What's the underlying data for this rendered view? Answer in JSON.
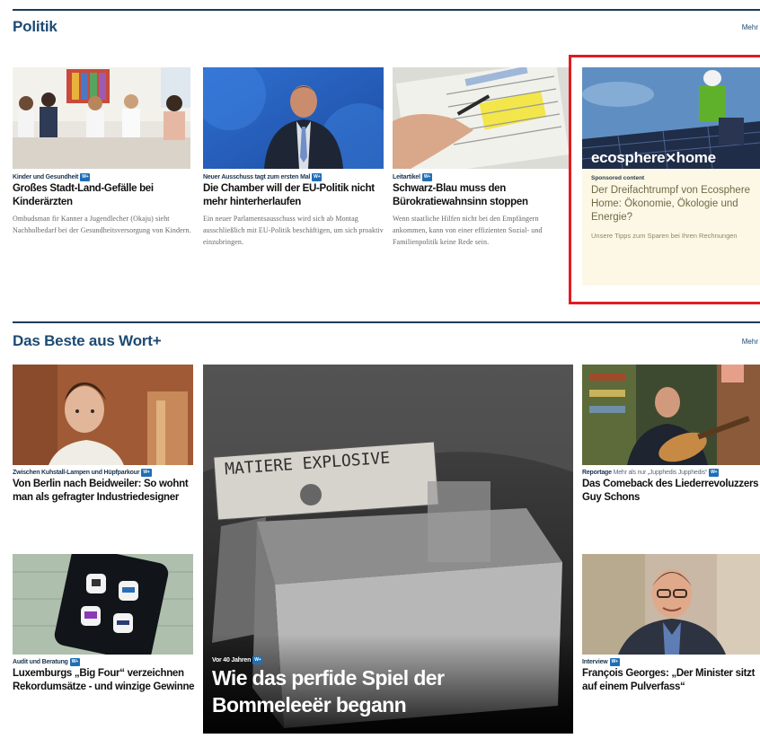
{
  "politik": {
    "title": "Politik",
    "more": "Mehr",
    "cards": [
      {
        "kicker": "Kinder und Gesundheit",
        "badge": "W+",
        "headline": "Großes Stadt-Land-Gefälle bei Kinderärzten",
        "teaser": "Ombudsman fir Kanner a Jugendlecher (Okaju) sieht Nachholbedarf bei der Gesundheitsversorgung von Kindern."
      },
      {
        "kicker": "Neuer Ausschuss tagt zum ersten Mal",
        "badge": "W+",
        "headline": "Die Chamber will der EU-Politik nicht mehr hinterherlaufen",
        "teaser": "Ein neuer Parlamentsausschuss wird sich ab Montag ausschließlich mit EU-Politik beschäftigen, um sich proaktiv einzubringen."
      },
      {
        "kicker": "Leitartikel",
        "badge": "W+",
        "headline": "Schwarz-Blau muss den Bürokratiewahnsinn stoppen",
        "teaser": "Wenn staatliche Hilfen nicht bei den Empfängern ankommen, kann von einer effizienten Sozial- und Familienpolitik keine Rede sein."
      }
    ],
    "sponsored": {
      "brand": "ecosphere",
      "brand_suffix": "home",
      "kicker": "Sponsored content",
      "headline": "Der Dreifachtrumpf von Ecosphere Home: Ökonomie, Ökologie und Energie?",
      "teaser": "Unsere Tipps zum Sparen bei Ihren Rechnungen"
    }
  },
  "wortplus": {
    "title": "Das Beste aus Wort+",
    "more": "Mehr",
    "cards": [
      {
        "kicker": "Zwischen Kuhstall-Lampen und Hüpfparkour",
        "badge": "W+",
        "headline": "Von Berlin nach Beidweiler: So wohnt man als gefragter Industriedesigner"
      },
      {
        "kicker": "Audit und Beratung",
        "badge": "W+",
        "headline": "Luxemburgs „Big Four“ verzeichnen Rekordumsätze - und winzige Gewinne"
      },
      {
        "kicker": "Vor 40 Jahren",
        "badge": "W+",
        "headline": "Wie das perfide Spiel der Bommeleeër begann",
        "image_text": "MATIERE EXPLOSIVE"
      },
      {
        "kicker": "Reportage",
        "kicker_extra": "Mehr als nur „Jupphedis Jupphedis“",
        "badge": "W+",
        "headline": "Das Comeback des Liederrevoluzzers Guy Schons"
      },
      {
        "kicker": "Interview",
        "badge": "W+",
        "headline": "François Georges: „Der Minister sitzt auf einem Pulverfass“"
      }
    ]
  },
  "colors": {
    "accent": "#1c4a72",
    "badge": "#1f6fb7",
    "highlight_frame": "#e01b22",
    "sponsored_bg": "#fdf8e6"
  }
}
